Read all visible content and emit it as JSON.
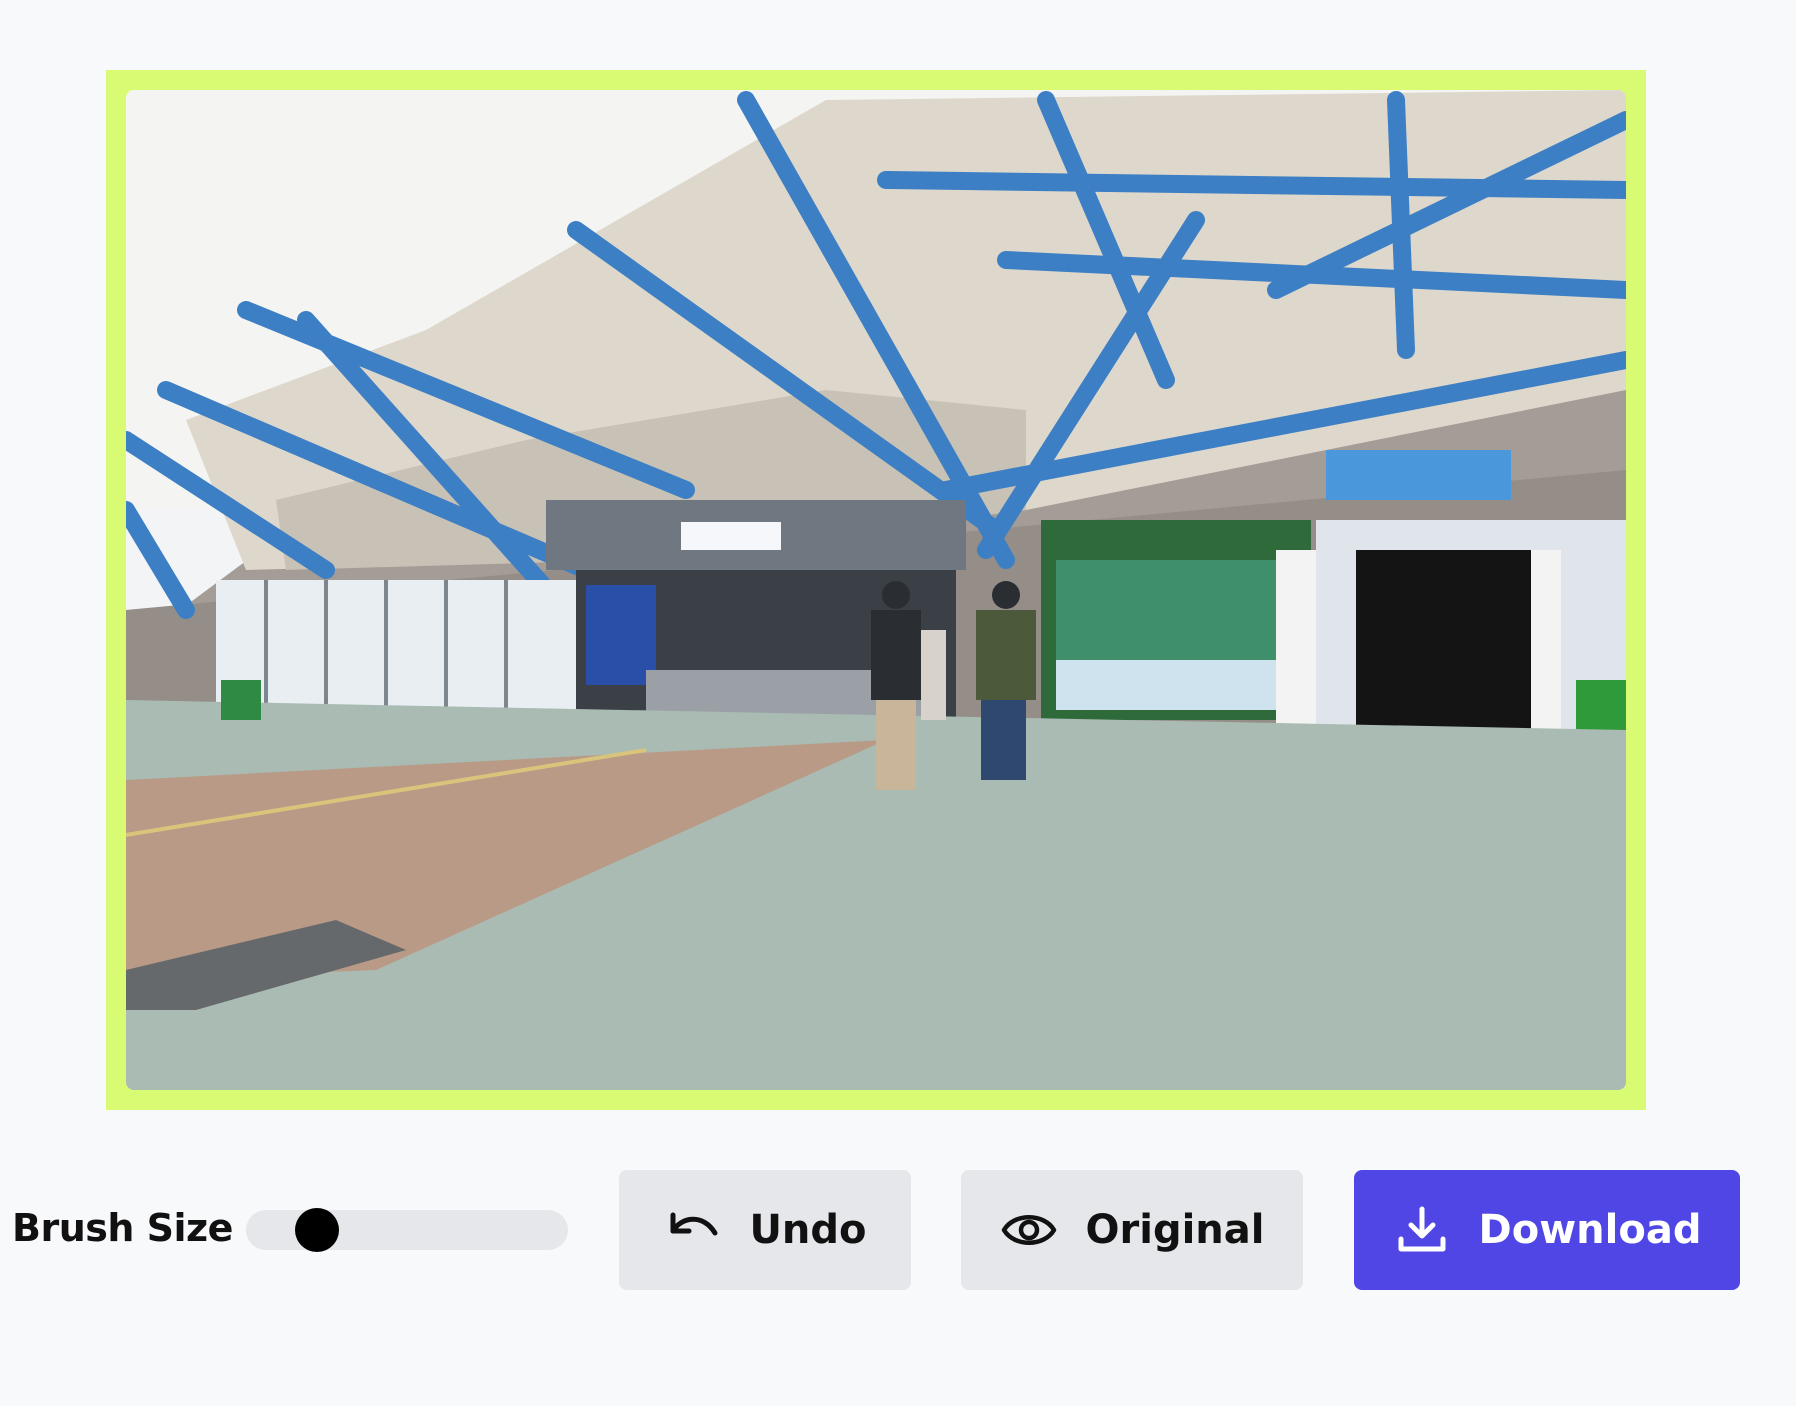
{
  "canvas": {
    "image_alt": "Station building with blue steel canopy",
    "frame_color": "#d9fb74"
  },
  "controls": {
    "brush_label": "Brush Size",
    "brush_value_fraction": 0.22
  },
  "buttons": {
    "undo_label": "Undo",
    "undo_icon": "undo-arrow-icon",
    "original_label": "Original",
    "original_icon": "eye-icon",
    "download_label": "Download",
    "download_icon": "download-icon",
    "download_color": "#4f46e5",
    "secondary_color": "#e5e7eb"
  }
}
